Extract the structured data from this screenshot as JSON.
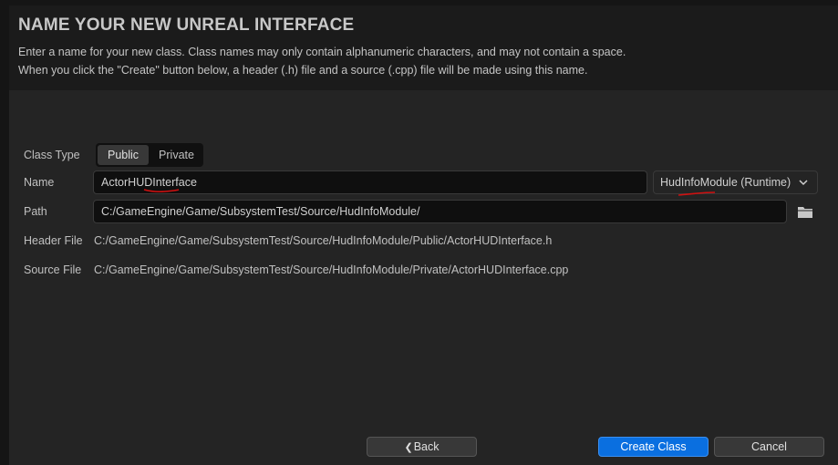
{
  "dialog": {
    "title": "NAME YOUR NEW UNREAL INTERFACE",
    "description_line1": "Enter a name for your new class. Class names may only contain alphanumeric characters, and may not contain a space.",
    "description_line2": "When you click the \"Create\" button below, a header (.h) file and a source (.cpp) file will be made using this name."
  },
  "form": {
    "class_type_label": "Class Type",
    "class_type_options": [
      "Public",
      "Private"
    ],
    "class_type_selected": "Public",
    "name_label": "Name",
    "name_value": "ActorHUDInterface",
    "module_value": "HudInfoModule (Runtime)",
    "path_label": "Path",
    "path_value": "C:/GameEngine/Game/SubsystemTest/Source/HudInfoModule/",
    "header_file_label": "Header File",
    "header_file_value": "C:/GameEngine/Game/SubsystemTest/Source/HudInfoModule/Public/ActorHUDInterface.h",
    "source_file_label": "Source File",
    "source_file_value": "C:/GameEngine/Game/SubsystemTest/Source/HudInfoModule/Private/ActorHUDInterface.cpp"
  },
  "footer": {
    "back_label": "Back",
    "create_label": "Create Class",
    "cancel_label": "Cancel"
  },
  "icons": {
    "back": "chevron-left-icon",
    "module_dropdown": "chevron-down-icon",
    "browse": "folder-icon"
  },
  "colors": {
    "accent": "#0a6fe0",
    "annotation": "#d01010"
  }
}
